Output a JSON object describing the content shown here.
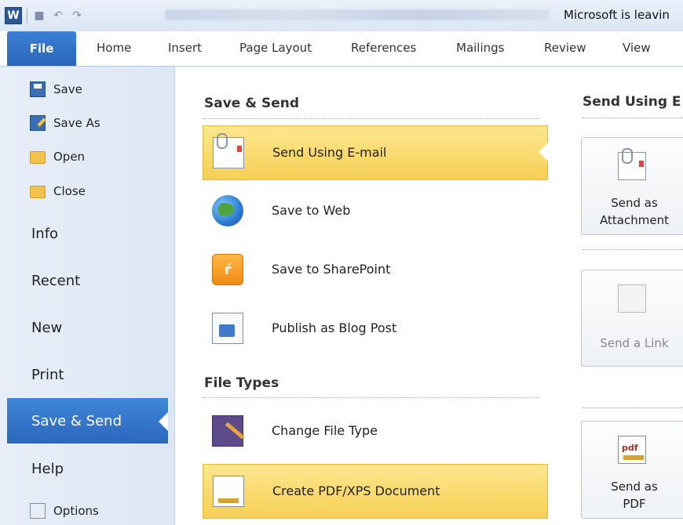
{
  "titlebar": {
    "app_title": "Microsoft is leavin",
    "qat_undo": "↶",
    "qat_redo": "↷"
  },
  "tabs": [
    "File",
    "Home",
    "Insert",
    "Page Layout",
    "References",
    "Mailings",
    "Review",
    "View"
  ],
  "nav": {
    "save": "Save",
    "save_as": "Save As",
    "open": "Open",
    "close": "Close",
    "info": "Info",
    "recent": "Recent",
    "new": "New",
    "print": "Print",
    "save_send": "Save & Send",
    "help": "Help",
    "options": "Options"
  },
  "middle": {
    "section1": "Save & Send",
    "items": [
      "Send Using E-mail",
      "Save to Web",
      "Save to SharePoint",
      "Publish as Blog Post"
    ],
    "section2": "File Types",
    "file_items": [
      "Change File Type",
      "Create PDF/XPS Document"
    ]
  },
  "right": {
    "title": "Send Using E",
    "attach_line1": "Send as",
    "attach_line2": "Attachment",
    "link": "Send a Link",
    "pdf_line1": "Send as",
    "pdf_line2": "PDF",
    "pdf_icon_text": "pdf"
  }
}
